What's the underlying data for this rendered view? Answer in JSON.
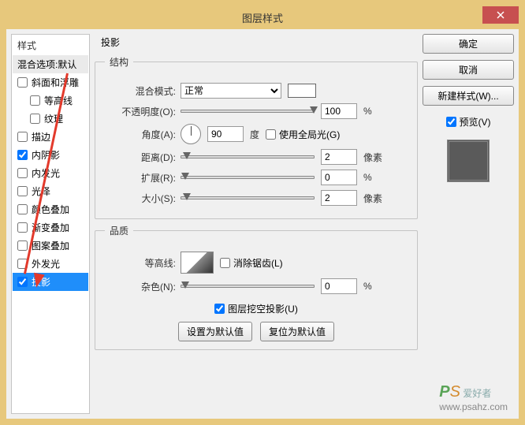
{
  "window": {
    "title": "图层样式"
  },
  "sidebar": {
    "header": "样式",
    "sub": "混合选项:默认",
    "items": [
      {
        "label": "斜面和浮雕",
        "checked": false,
        "indent": false
      },
      {
        "label": "等高线",
        "checked": false,
        "indent": true
      },
      {
        "label": "纹理",
        "checked": false,
        "indent": true
      },
      {
        "label": "描边",
        "checked": false,
        "indent": false
      },
      {
        "label": "内阴影",
        "checked": true,
        "indent": false
      },
      {
        "label": "内发光",
        "checked": false,
        "indent": false
      },
      {
        "label": "光泽",
        "checked": false,
        "indent": false
      },
      {
        "label": "颜色叠加",
        "checked": false,
        "indent": false
      },
      {
        "label": "渐变叠加",
        "checked": false,
        "indent": false
      },
      {
        "label": "图案叠加",
        "checked": false,
        "indent": false
      },
      {
        "label": "外发光",
        "checked": false,
        "indent": false
      },
      {
        "label": "投影",
        "checked": true,
        "indent": false,
        "selected": true
      }
    ]
  },
  "main": {
    "heading": "投影",
    "structure": {
      "legend": "结构",
      "blend_mode_label": "混合模式:",
      "blend_mode_value": "正常",
      "opacity_label": "不透明度(O):",
      "opacity_value": "100",
      "opacity_unit": "%",
      "angle_label": "角度(A):",
      "angle_value": "90",
      "angle_unit": "度",
      "global_light_label": "使用全局光(G)",
      "global_light_checked": false,
      "distance_label": "距离(D):",
      "distance_value": "2",
      "distance_unit": "像素",
      "spread_label": "扩展(R):",
      "spread_value": "0",
      "spread_unit": "%",
      "size_label": "大小(S):",
      "size_value": "2",
      "size_unit": "像素"
    },
    "quality": {
      "legend": "品质",
      "contour_label": "等高线:",
      "antialias_label": "消除锯齿(L)",
      "antialias_checked": false,
      "noise_label": "杂色(N):",
      "noise_value": "0",
      "noise_unit": "%"
    },
    "knockout_label": "图层挖空投影(U)",
    "knockout_checked": true,
    "btn_default": "设置为默认值",
    "btn_reset": "复位为默认值"
  },
  "right": {
    "ok": "确定",
    "cancel": "取消",
    "new_style": "新建样式(W)...",
    "preview_label": "预览(V)",
    "preview_checked": true
  },
  "watermark": {
    "brand1": "P",
    "brand2": "S",
    "text": "爱好者",
    "url": "www.psahz.com"
  }
}
